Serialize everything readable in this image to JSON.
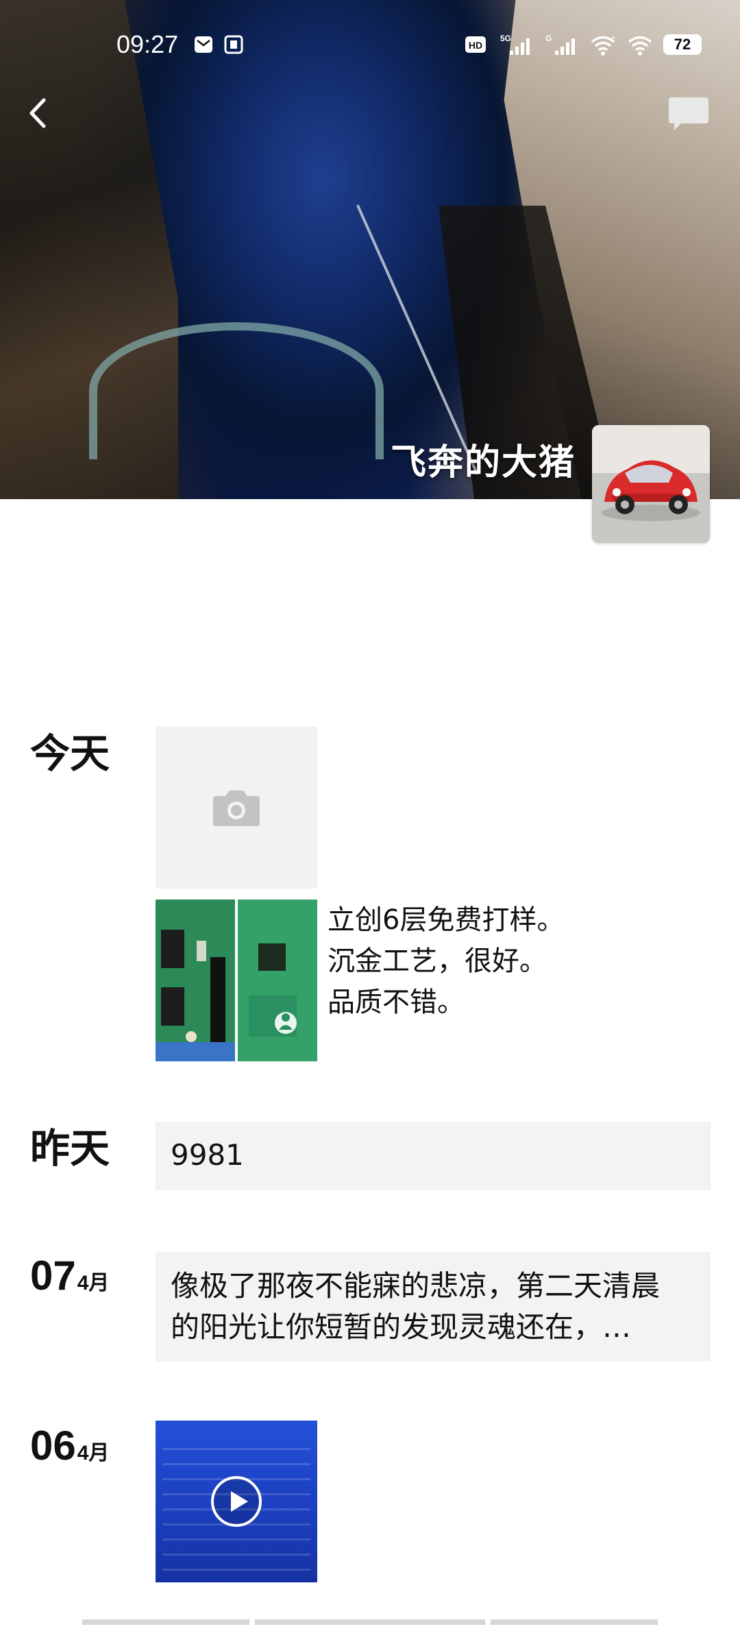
{
  "status_bar": {
    "time": "09:27",
    "network_label": "5G",
    "network_label_2": "G",
    "hd_label": "HD",
    "battery": "72"
  },
  "header": {
    "back_icon": "chevron-left-icon",
    "message_icon": "chat-bubble-icon"
  },
  "profile": {
    "name": "飞奔的大猪"
  },
  "timeline": {
    "today_label": "今天",
    "yesterday_label": "昨天",
    "posts": [
      {
        "type": "camera_placeholder"
      },
      {
        "type": "image_text",
        "text_lines": [
          "立创6层免费打样。",
          "沉金工艺，很好。",
          "品质不错。"
        ]
      },
      {
        "type": "text_card",
        "text": "9981"
      },
      {
        "day": "07",
        "month": "4月",
        "type": "text_card",
        "text_line_1": "像极了那夜不能寐的悲凉，第二天清晨",
        "text_line_2": "的阳光让你短暂的发现灵魂还在，…"
      },
      {
        "day": "06",
        "month": "4月",
        "type": "video"
      }
    ]
  },
  "colors": {
    "text": "#111111",
    "card_bg": "#f3f3f3",
    "placeholder_bg": "#f2f2f2",
    "white": "#ffffff"
  }
}
